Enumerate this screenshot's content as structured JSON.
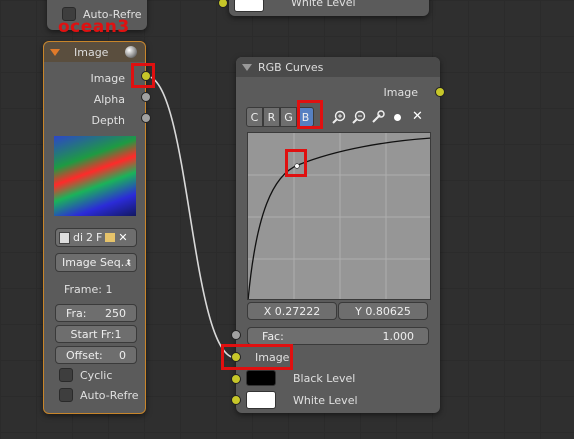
{
  "top_fragment": {
    "auto_refresh_label": "Auto-Refre",
    "white_level_label": "White Level"
  },
  "overlay_label": "ocean3",
  "image_node": {
    "title": "Image",
    "outputs": [
      "Image",
      "Alpha",
      "Depth"
    ],
    "file_buttons": [
      "di",
      "2",
      "F"
    ],
    "source_select": "Image Seq…",
    "frame_label": "Frame: 1",
    "frames_field": {
      "label": "Fra:",
      "value": "250"
    },
    "start_field": "Start Fr:1",
    "offset_field": {
      "label": "Offset:",
      "value": "0"
    },
    "cyclic_label": "Cyclic",
    "auto_refresh_label": "Auto-Refre"
  },
  "curves_node": {
    "title": "RGB Curves",
    "output_label": "Image",
    "channel_tabs": [
      "C",
      "R",
      "G",
      "B"
    ],
    "active_channel": "B",
    "tool_icons": [
      "zoom-in-icon",
      "zoom-out-icon",
      "wrench-icon",
      "dot-icon",
      "close-icon"
    ],
    "x_field": "X 0.27222",
    "y_field": "Y 0.80625",
    "fac_label": "Fac:",
    "fac_value": "1.000",
    "inputs": [
      "Image",
      "Black Level",
      "White Level"
    ],
    "accent_color": "#5680c2",
    "socket_color": "#c7c729"
  }
}
